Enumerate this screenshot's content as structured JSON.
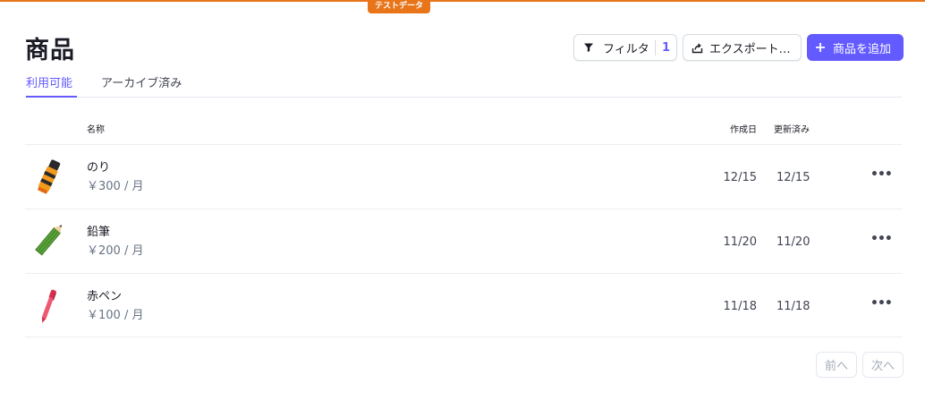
{
  "banner": {
    "label": "テストデータ",
    "color": "#e8751a"
  },
  "header": {
    "title": "商品",
    "filter_label": "フィルタ",
    "filter_count": "1",
    "export_label": "エクスポート…",
    "add_label": "商品を追加",
    "accent_color": "#635bff"
  },
  "tabs": [
    {
      "label": "利用可能",
      "active": true
    },
    {
      "label": "アーカイブ済み",
      "active": false
    }
  ],
  "table": {
    "columns": {
      "name": "名称",
      "created": "作成日",
      "updated": "更新済み"
    },
    "rows": [
      {
        "name": "のり",
        "price": "￥300 / 月",
        "created": "12/15",
        "updated": "12/15",
        "icon": "glue-stick-icon"
      },
      {
        "name": "鉛筆",
        "price": "￥200 / 月",
        "created": "11/20",
        "updated": "11/20",
        "icon": "pencil-icon"
      },
      {
        "name": "赤ペン",
        "price": "￥100 / 月",
        "created": "11/18",
        "updated": "11/18",
        "icon": "red-pen-icon"
      }
    ]
  },
  "pagination": {
    "prev_label": "前へ",
    "next_label": "次へ"
  }
}
